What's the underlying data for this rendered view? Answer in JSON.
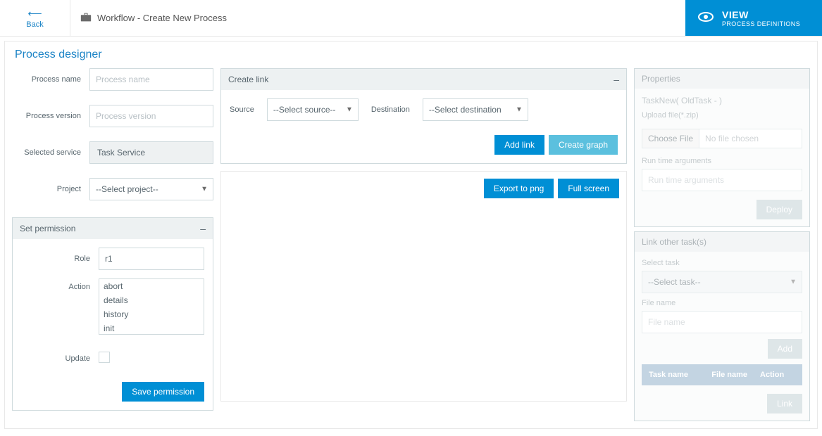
{
  "topbar": {
    "back": "Back",
    "title": "Workflow - Create New Process",
    "view_title": "VIEW",
    "view_sub": "PROCESS DEFINITIONS"
  },
  "designer": {
    "title": "Process designer"
  },
  "left": {
    "process_name_lbl": "Process name",
    "process_name_ph": "Process name",
    "process_version_lbl": "Process version",
    "process_version_ph": "Process version",
    "selected_service_lbl": "Selected service",
    "selected_service_val": "Task Service",
    "project_lbl": "Project",
    "project_selected": "--Select project--"
  },
  "permission": {
    "panel_title": "Set permission",
    "collapse": "–",
    "role_lbl": "Role",
    "role_val": "r1",
    "action_lbl": "Action",
    "actions": [
      "abort",
      "details",
      "history",
      "init"
    ],
    "update_lbl": "Update",
    "save_btn": "Save permission"
  },
  "mid": {
    "create_link_title": "Create link",
    "collapse": "–",
    "source_lbl": "Source",
    "source_sel": "--Select source--",
    "dest_lbl": "Destination",
    "dest_sel": "--Select destination",
    "add_link_btn": "Add link",
    "create_graph_btn": "Create graph",
    "export_btn": "Export to png",
    "fullscreen_btn": "Full screen"
  },
  "props": {
    "title": "Properties",
    "task_label": "TaskNew( OldTask - )",
    "upload_lbl": "Upload file(*.zip)",
    "choose_file": "Choose File",
    "no_file": "No file chosen",
    "runtime_lbl": "Run time arguments",
    "runtime_ph": "Run time arguments",
    "deploy_btn": "Deploy"
  },
  "linkother": {
    "title": "Link other task(s)",
    "select_task_lbl": "Select task",
    "select_task_sel": "--Select task--",
    "file_name_lbl": "File name",
    "file_name_ph": "File name",
    "add_btn": "Add",
    "table": {
      "col1": "Task name",
      "col2": "File name",
      "col3": "Action"
    },
    "link_btn": "Link"
  }
}
